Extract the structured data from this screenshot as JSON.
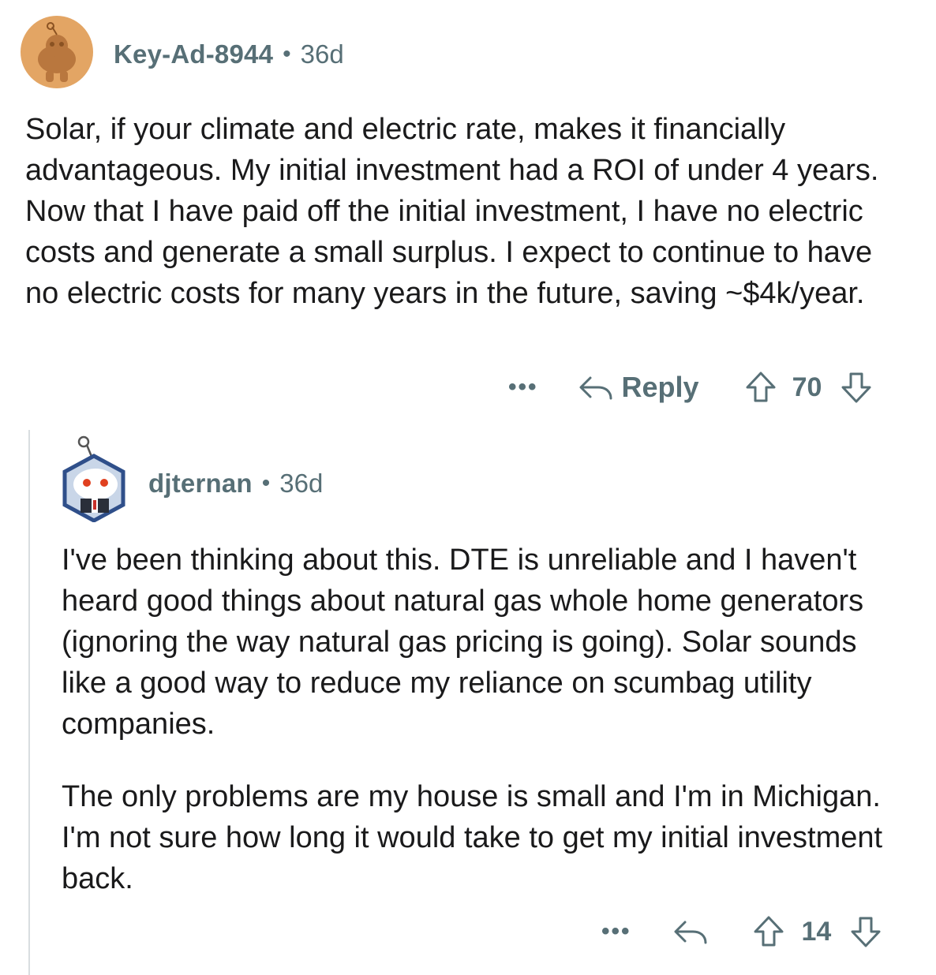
{
  "comments": [
    {
      "username": "Key-Ad-8944",
      "separator": "•",
      "age": "36d",
      "body": "Solar, if your climate and electric rate, makes it financially advantageous.  My initial investment had a ROI of under 4 years.  Now that I have paid off the initial investment, I have no electric costs and generate a small surplus.  I expect to continue to have no electric costs for many years in the future, saving ~$4k/year.",
      "actions": {
        "more": "•••",
        "reply": "Reply",
        "score": "70"
      },
      "avatar_icon": "snoo-avatar-orange-icon"
    },
    {
      "username": "djternan",
      "separator": "•",
      "age": "36d",
      "body_paragraphs": [
        "I've been thinking about this.  DTE is unreliable and I haven't heard good things about natural gas whole home generators (ignoring the way natural gas pricing is going).  Solar sounds like a good way to reduce my reliance on scumbag utility companies.",
        "The only problems are my house is small and I'm in Michigan.  I'm not sure how long it would take to get my initial investment back."
      ],
      "actions": {
        "more": "•••",
        "score": "14"
      },
      "avatar_icon": "snoo-avatar-hexagon-icon"
    }
  ],
  "colors": {
    "meta_text": "#576f76",
    "body_text": "#1a1a1b",
    "avatar1_bg": "#e3a564",
    "avatar2_border": "#2f4f8a",
    "thread_line": "#d9dde0"
  }
}
